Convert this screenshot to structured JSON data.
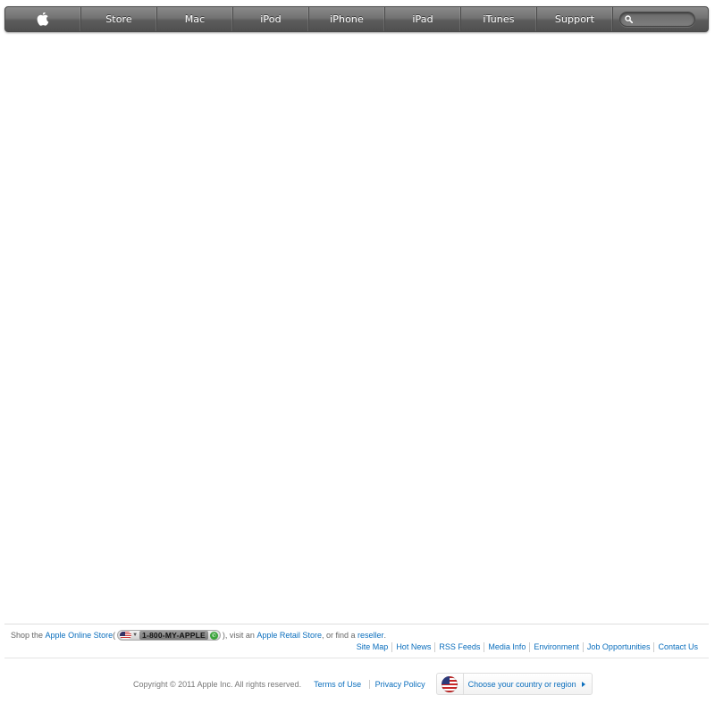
{
  "nav": {
    "items": [
      {
        "id": "store",
        "label": "Store"
      },
      {
        "id": "mac",
        "label": "Mac"
      },
      {
        "id": "ipod",
        "label": "iPod"
      },
      {
        "id": "iphone",
        "label": "iPhone"
      },
      {
        "id": "ipad",
        "label": "iPad"
      },
      {
        "id": "itunes",
        "label": "iTunes"
      },
      {
        "id": "support",
        "label": "Support"
      }
    ],
    "logo_icon": "apple-logo-icon",
    "search_icon": "search-icon",
    "search_placeholder": ""
  },
  "footer": {
    "shop": {
      "prefix": "Shop the ",
      "online_store": "Apple Online Store",
      "open_paren": " (",
      "phone": "1-800-MY-APPLE",
      "after_phone": "), visit an ",
      "retail_store": "Apple Retail Store",
      "or_find": ", or find a ",
      "reseller": "reseller",
      "period": "."
    },
    "links": [
      "Site Map",
      "Hot News",
      "RSS Feeds",
      "Media Info",
      "Environment",
      "Job Opportunities",
      "Contact Us"
    ],
    "copyright": "Copyright © 2011 Apple Inc. All rights reserved.",
    "terms": "Terms of Use",
    "privacy": "Privacy Policy",
    "country_label": "Choose your country or region"
  },
  "colors": {
    "link": "#0a6ebd",
    "nav_bg": "#6a6a6a"
  }
}
